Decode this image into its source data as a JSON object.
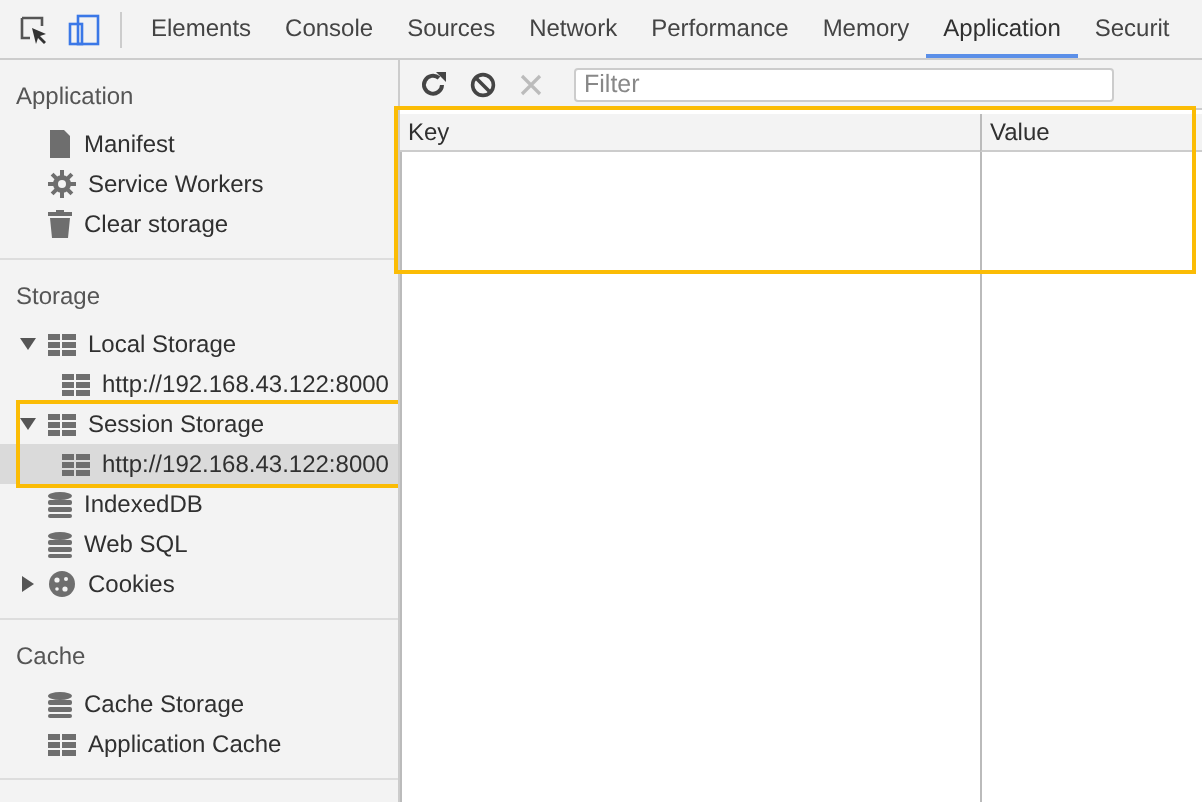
{
  "toolbar": {
    "tabs": [
      {
        "label": "Elements",
        "selected": false
      },
      {
        "label": "Console",
        "selected": false
      },
      {
        "label": "Sources",
        "selected": false
      },
      {
        "label": "Network",
        "selected": false
      },
      {
        "label": "Performance",
        "selected": false
      },
      {
        "label": "Memory",
        "selected": false
      },
      {
        "label": "Application",
        "selected": true
      },
      {
        "label": "Securit",
        "selected": false
      }
    ]
  },
  "sidebar": {
    "sections": [
      {
        "title": "Application",
        "items": [
          {
            "label": "Manifest",
            "kind": "file",
            "selected": false
          },
          {
            "label": "Service Workers",
            "kind": "gear",
            "selected": false
          },
          {
            "label": "Clear storage",
            "kind": "trash",
            "selected": false
          }
        ]
      },
      {
        "title": "Storage",
        "items": [
          {
            "label": "Local Storage",
            "kind": "grid",
            "selected": false,
            "expanded": true,
            "children": [
              {
                "label": "http://192.168.43.122:8000",
                "kind": "grid",
                "selected": false
              }
            ]
          },
          {
            "label": "Session Storage",
            "kind": "grid",
            "selected": false,
            "expanded": true,
            "highlighted": true,
            "children": [
              {
                "label": "http://192.168.43.122:8000",
                "kind": "grid",
                "selected": true
              }
            ]
          },
          {
            "label": "IndexedDB",
            "kind": "db",
            "selected": false
          },
          {
            "label": "Web SQL",
            "kind": "db",
            "selected": false
          },
          {
            "label": "Cookies",
            "kind": "cookie",
            "selected": false,
            "expanded": false
          }
        ]
      },
      {
        "title": "Cache",
        "items": [
          {
            "label": "Cache Storage",
            "kind": "db",
            "selected": false
          },
          {
            "label": "Application Cache",
            "kind": "grid",
            "selected": false
          }
        ]
      }
    ]
  },
  "storage_view": {
    "filter": {
      "placeholder": "Filter"
    },
    "table": {
      "columns": [
        "Key",
        "Value"
      ],
      "highlighted": true
    }
  }
}
